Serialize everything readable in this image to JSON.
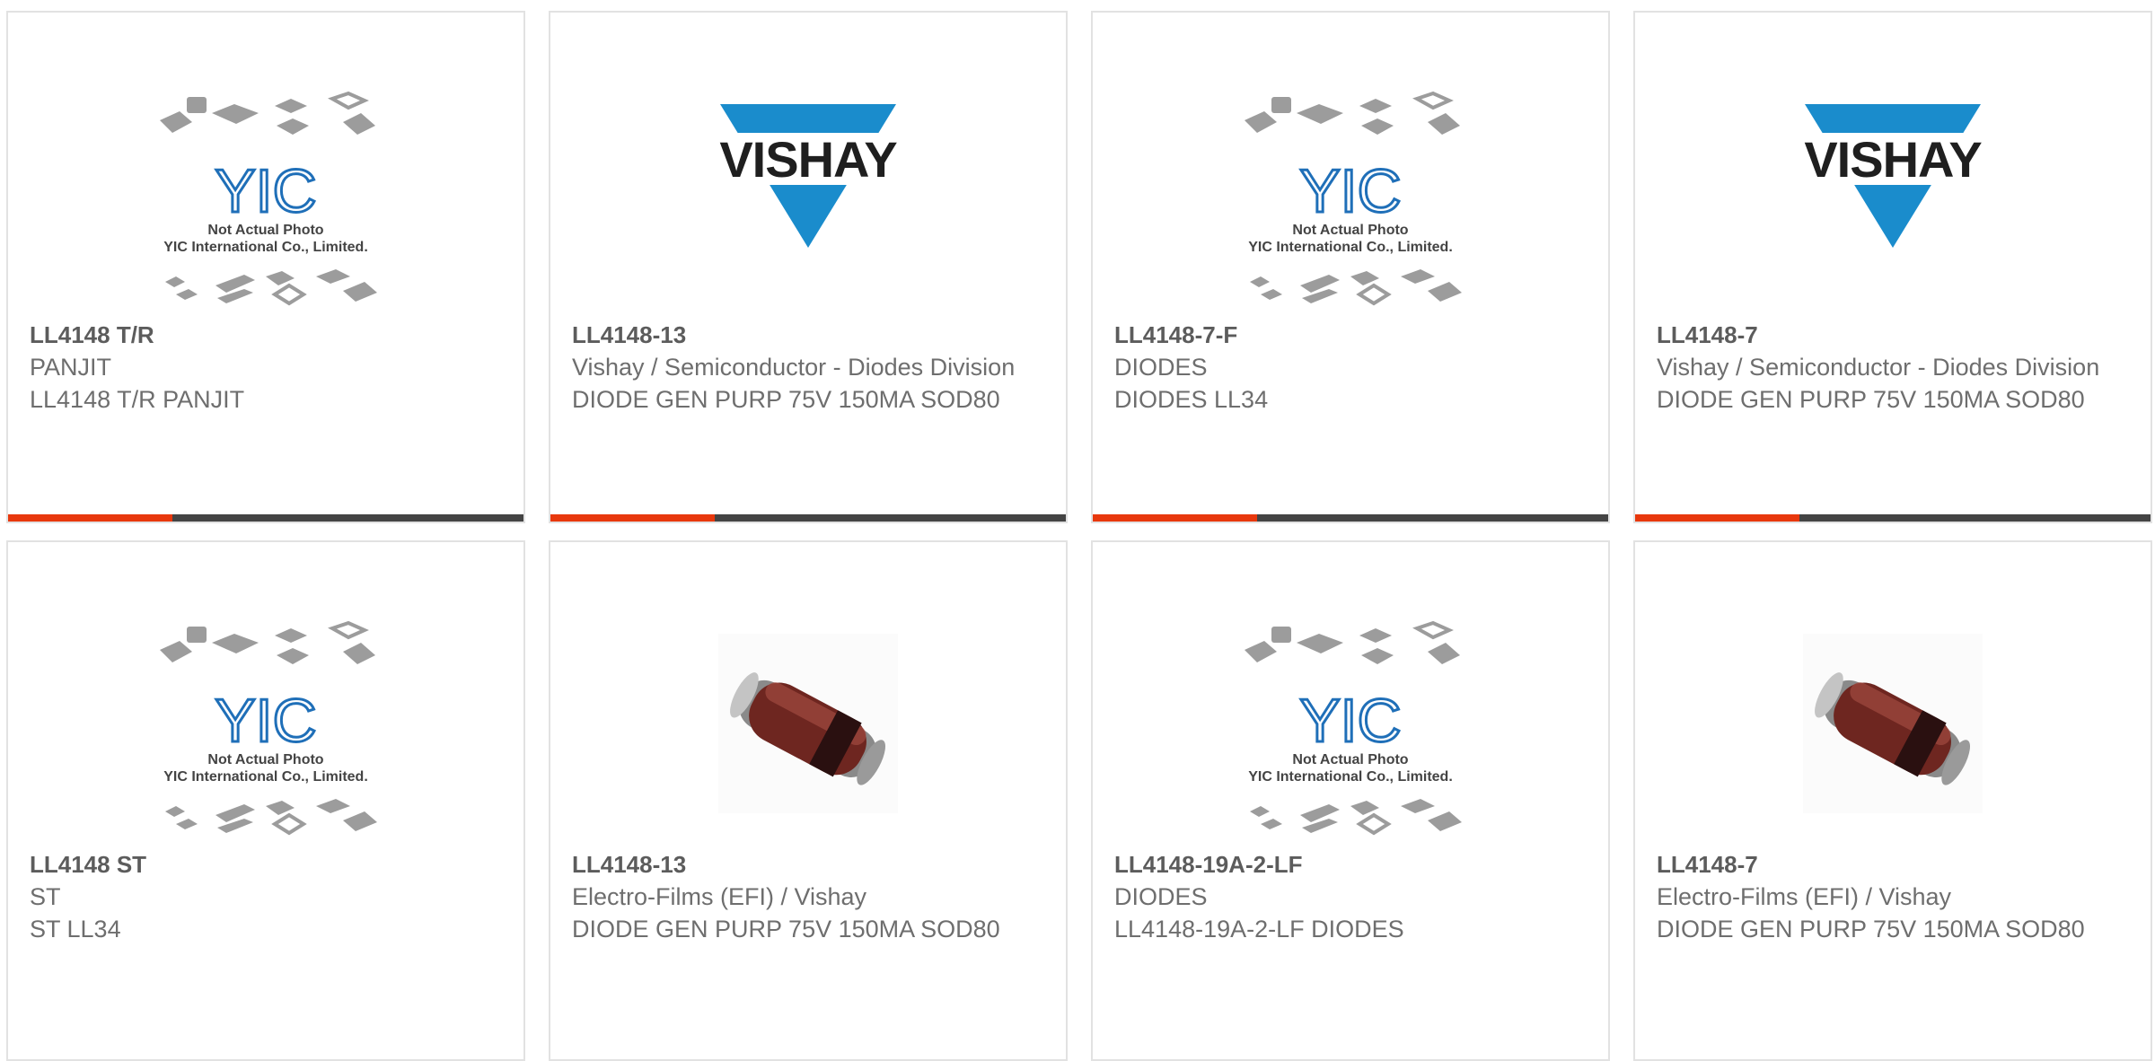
{
  "colors": {
    "accent": "#e8380d",
    "bar": "#444444",
    "border": "#e2e2e2",
    "vishay_blue": "#1a8ccc",
    "yic_blue": "#1f6fb8"
  },
  "products": [
    {
      "part": "LL4148 T/R",
      "manufacturer": "PANJIT",
      "description": "LL4148 T/R PANJIT",
      "image": "yic-placeholder",
      "image_text_1": "Not Actual Photo",
      "image_text_2": "YIC International Co., Limited.",
      "image_logo": "YIC"
    },
    {
      "part": "LL4148-13",
      "manufacturer": "Vishay / Semiconductor - Diodes Division",
      "description": "DIODE GEN PURP 75V 150MA SOD80",
      "image": "vishay-logo",
      "image_logo": "VISHAY"
    },
    {
      "part": "LL4148-7-F",
      "manufacturer": "DIODES",
      "description": "DIODES LL34",
      "image": "yic-placeholder",
      "image_text_1": "Not Actual Photo",
      "image_text_2": "YIC International Co., Limited.",
      "image_logo": "YIC"
    },
    {
      "part": "LL4148-7",
      "manufacturer": "Vishay / Semiconductor - Diodes Division",
      "description": "DIODE GEN PURP 75V 150MA SOD80",
      "image": "vishay-logo",
      "image_logo": "VISHAY"
    },
    {
      "part": "LL4148 ST",
      "manufacturer": "ST",
      "description": "ST LL34",
      "image": "yic-placeholder",
      "image_text_1": "Not Actual Photo",
      "image_text_2": "YIC International Co., Limited.",
      "image_logo": "YIC"
    },
    {
      "part": "LL4148-13",
      "manufacturer": "Electro-Films (EFI) / Vishay",
      "description": "DIODE GEN PURP 75V 150MA SOD80",
      "image": "diode-photo"
    },
    {
      "part": "LL4148-19A-2-LF",
      "manufacturer": "DIODES",
      "description": "LL4148-19A-2-LF DIODES",
      "image": "yic-placeholder",
      "image_text_1": "Not Actual Photo",
      "image_text_2": "YIC International Co., Limited.",
      "image_logo": "YIC"
    },
    {
      "part": "LL4148-7",
      "manufacturer": "Electro-Films (EFI) / Vishay",
      "description": "DIODE GEN PURP 75V 150MA SOD80",
      "image": "diode-photo"
    }
  ]
}
